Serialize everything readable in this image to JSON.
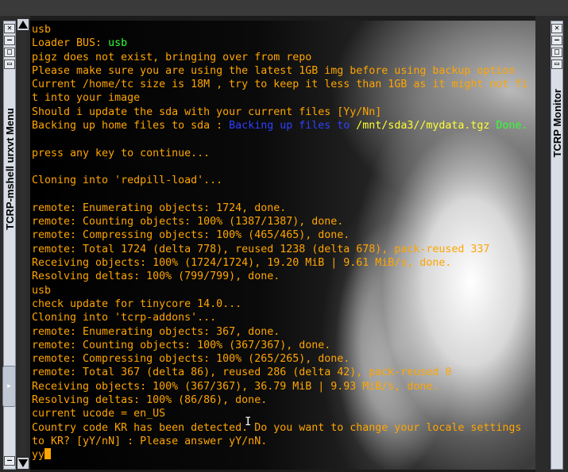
{
  "left_window": {
    "title": "TCRP-mshell urxvt Menu",
    "close_glyph": "✕",
    "minimize_glyph": "–",
    "maximize_glyph": "□",
    "restore_glyph": "▭",
    "expand_glyph": "▸"
  },
  "right_window": {
    "title": "TCRP Monitor",
    "close_glyph": "✕",
    "minimize_glyph": "–",
    "maximize_glyph": "□",
    "restore_glyph": "▭"
  },
  "terminal": {
    "lines": [
      "usb",
      "Loader BUS: ",
      "usb",
      "pigz does not exist, bringing over from repo",
      "Please make sure you are using the latest 1GB img before using backup option",
      "Current /home/tc size is 18M , try to keep it less than 1GB as it might not fi",
      "t into your image",
      "Should i update the sda with your current files [Yy/Nn]",
      "Backing up home files to sda : ",
      "Backing up files to ",
      "/mnt/sda3//mydata.tgz",
      " Done.",
      "press any key to continue...",
      "Cloning into 'redpill-load'...",
      "remote: Enumerating objects: 1724, done.",
      "remote: Counting objects: 100% (1387/1387), done.",
      "remote: Compressing objects: 100% (465/465), done.",
      "remote: Total 1724 (delta 778), reused 1238 (delta 678), pack-reused 337",
      "Receiving objects: 100% (1724/1724), 19.20 MiB | 9.61 MiB/s, done.",
      "Resolving deltas: 100% (799/799), done.",
      "usb",
      "check update for tinycore 14.0...",
      "Cloning into 'tcrp-addons'...",
      "remote: Enumerating objects: 367, done.",
      "remote: Counting objects: 100% (367/367), done.",
      "remote: Compressing objects: 100% (265/265), done.",
      "remote: Total 367 (delta 86), reused 286 (delta 42), pack-reused 0",
      "Receiving objects: 100% (367/367), 36.79 MiB | 9.93 MiB/s, done.",
      "Resolving deltas: 100% (86/86), done.",
      "current ucode = en_US",
      "Country code KR has been detected. Do you want to change your locale settings",
      "to KR? [yY/nN] : Please answer yY/nN.",
      "yy"
    ],
    "ibeam_glyph": "I"
  },
  "colors": {
    "terminal_text": "#ffa500",
    "highlight_green": "#33ff33",
    "highlight_blue": "#3040ff",
    "highlight_yellow": "#ffff33"
  }
}
